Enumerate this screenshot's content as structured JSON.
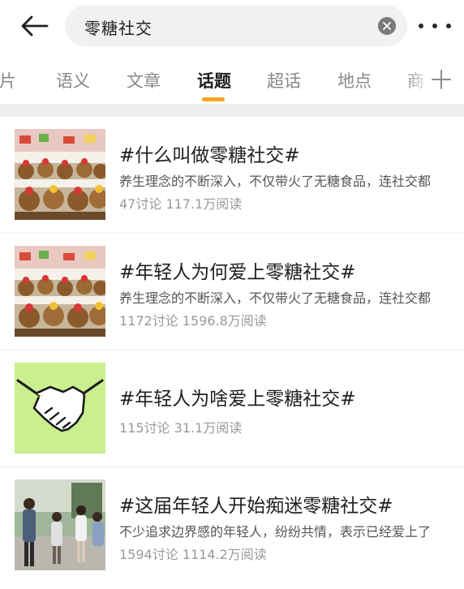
{
  "search": {
    "query": "零糖社交"
  },
  "tabs": [
    {
      "label": "图片"
    },
    {
      "label": "语义"
    },
    {
      "label": "文章"
    },
    {
      "label": "话题"
    },
    {
      "label": "超话"
    },
    {
      "label": "地点"
    },
    {
      "label": "商"
    }
  ],
  "active_tab": "话题",
  "colors": {
    "accent": "#f5a623",
    "search_bg": "#f1f1f1",
    "handshake_bg": "#c9ef8e"
  },
  "topics": [
    {
      "title": "#什么叫做零糖社交#",
      "desc": "养生理念的不断深入，不仅带火了无糖食品，连社交都",
      "stats": "47讨论 117.1万阅读",
      "thumb": "plush-toys"
    },
    {
      "title": "#年轻人为何爱上零糖社交#",
      "desc": "养生理念的不断深入，不仅带火了无糖食品，连社交都",
      "stats": "1172讨论 1596.8万阅读",
      "thumb": "plush-toys"
    },
    {
      "title": "#年轻人为啥爱上零糖社交#",
      "desc": "",
      "stats": "115讨论 31.1万阅读",
      "thumb": "handshake"
    },
    {
      "title": "#这届年轻人开始痴迷零糖社交#",
      "desc": "不少追求边界感的年轻人，纷纷共情，表示已经爱上了",
      "stats": "1594讨论 1114.2万阅读",
      "thumb": "people-outdoor"
    }
  ]
}
